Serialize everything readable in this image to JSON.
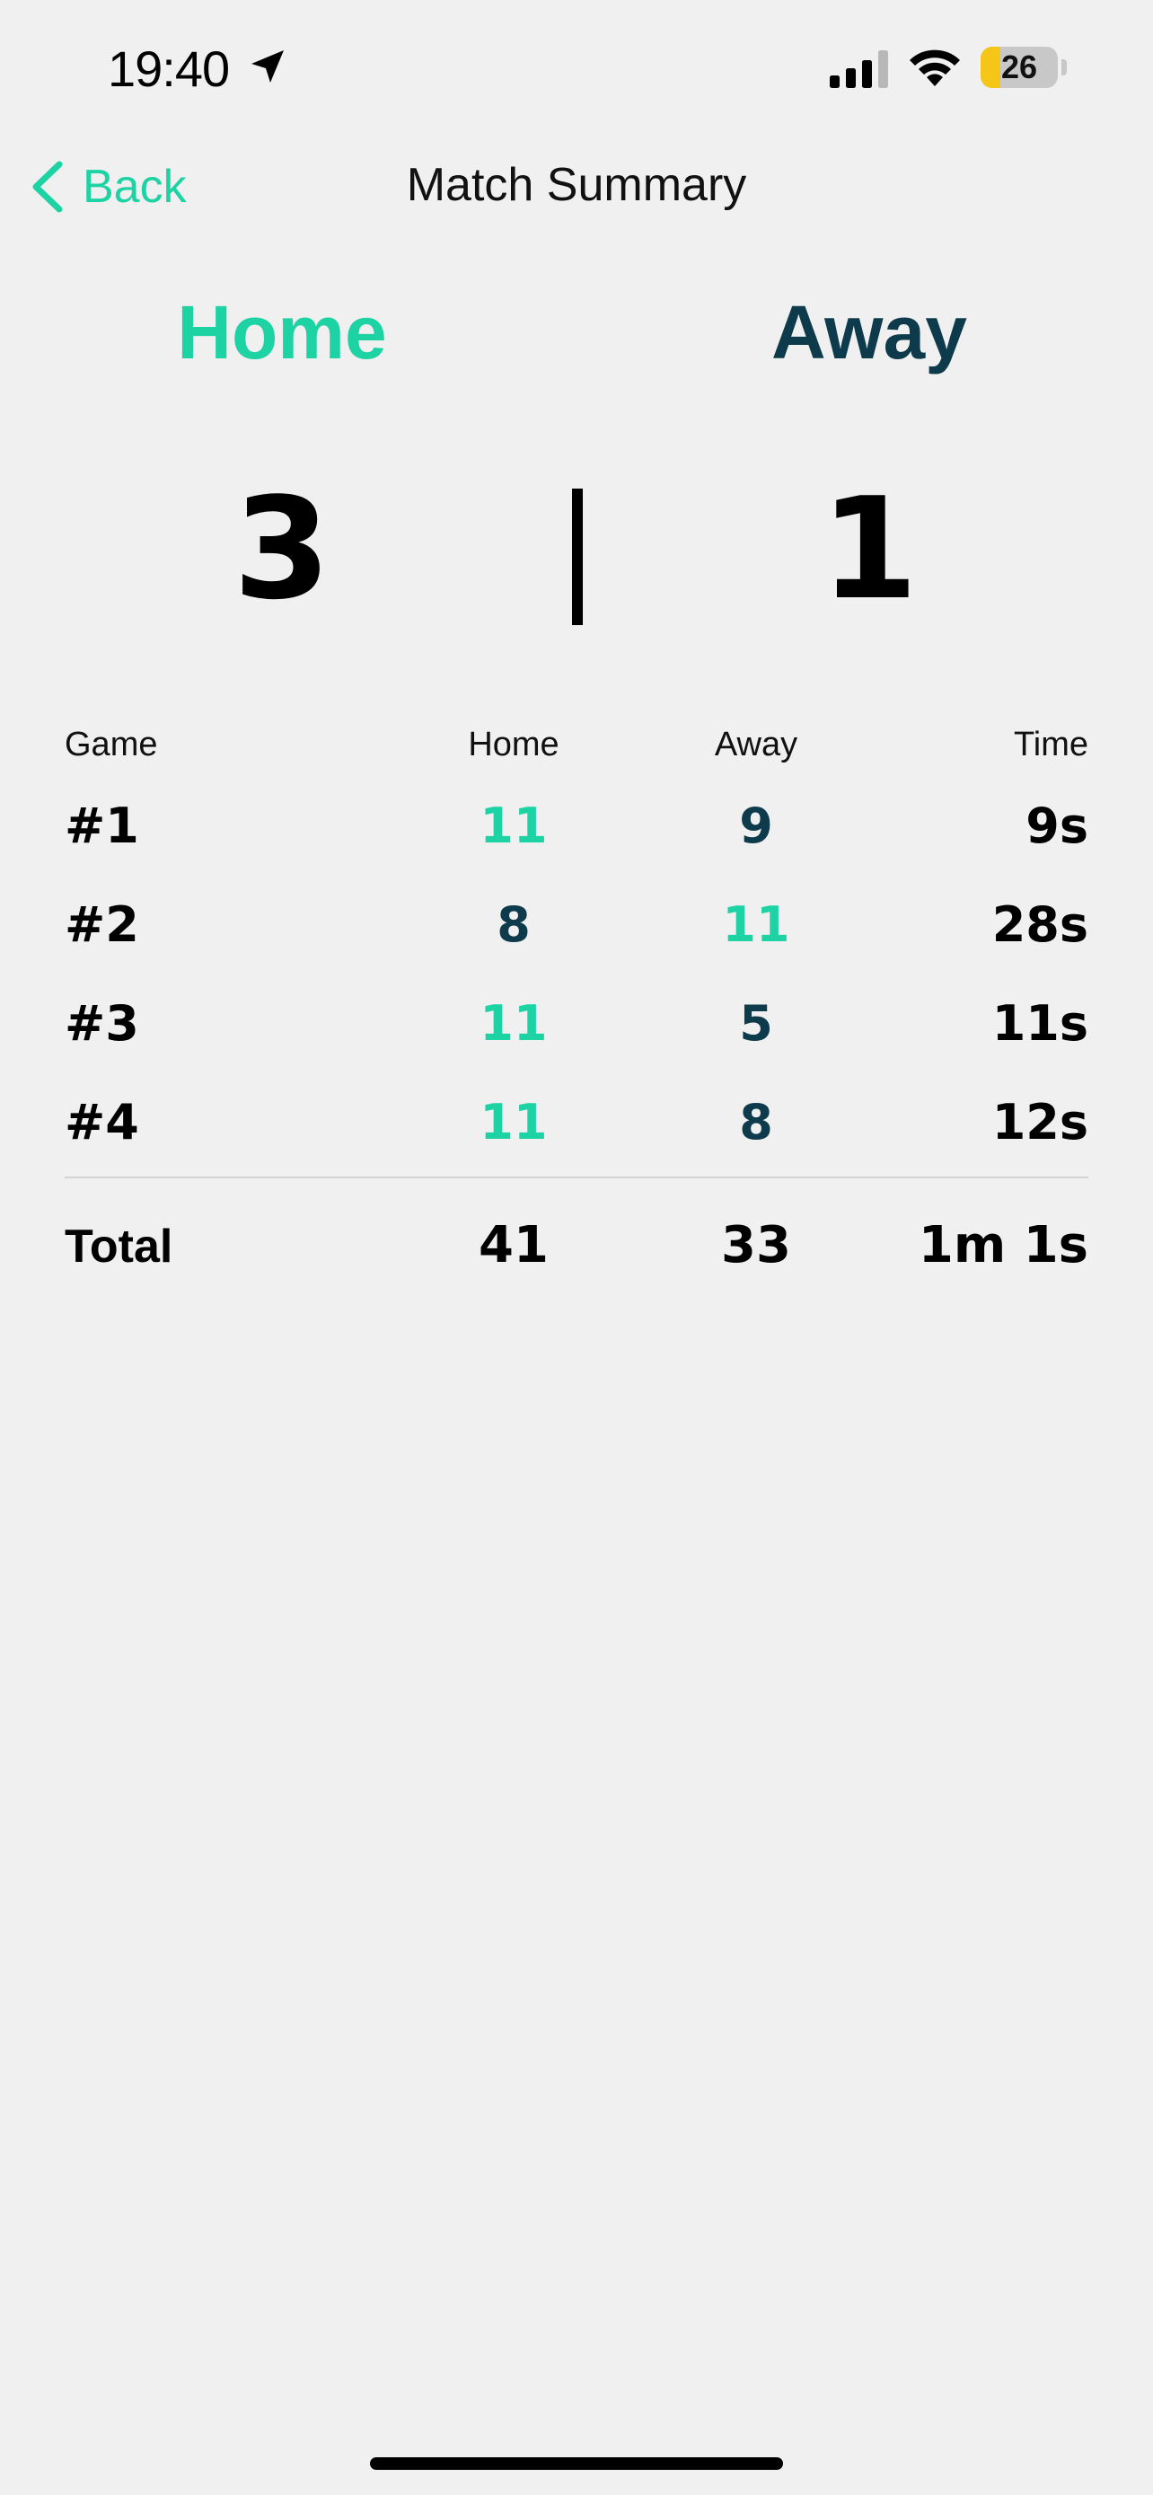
{
  "status_bar": {
    "time": "19:40",
    "battery_level": "26",
    "battery_fraction": 0.26,
    "battery_color": "#f5c518"
  },
  "nav": {
    "back_label": "Back",
    "title": "Match Summary"
  },
  "teams": {
    "home": "Home",
    "away": "Away",
    "home_color": "#1dd3a3",
    "away_color": "#0e3b4b"
  },
  "score": {
    "home": "3",
    "away": "1"
  },
  "table": {
    "headers": {
      "game": "Game",
      "home": "Home",
      "away": "Away",
      "time": "Time"
    },
    "rows": [
      {
        "game": "#1",
        "home": "11",
        "away": "9",
        "time": "9s",
        "winner": "home"
      },
      {
        "game": "#2",
        "home": "8",
        "away": "11",
        "time": "28s",
        "winner": "away"
      },
      {
        "game": "#3",
        "home": "11",
        "away": "5",
        "time": "11s",
        "winner": "home"
      },
      {
        "game": "#4",
        "home": "11",
        "away": "8",
        "time": "12s",
        "winner": "home"
      }
    ],
    "total": {
      "label": "Total",
      "home": "41",
      "away": "33",
      "time": "1m 1s"
    }
  },
  "icons": {
    "location": "location-arrow-icon",
    "signal": "cellular-signal-icon",
    "wifi": "wifi-icon",
    "back": "chevron-left-icon"
  }
}
